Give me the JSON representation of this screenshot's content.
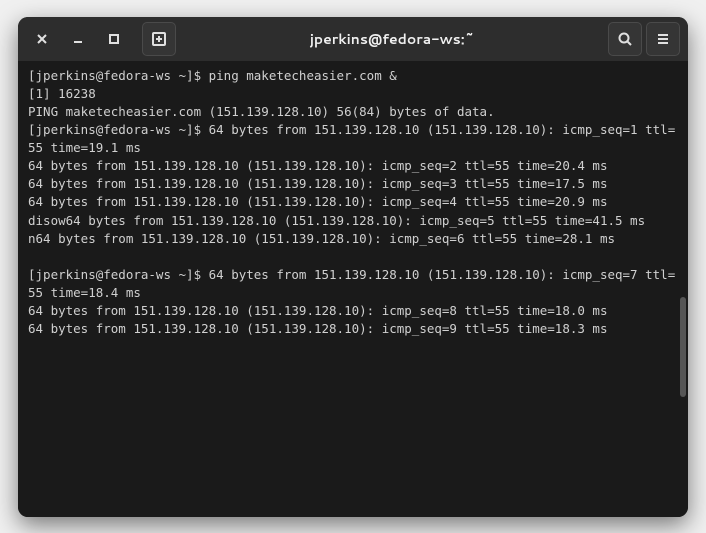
{
  "window": {
    "title": "jperkins@fedora-ws:~"
  },
  "terminal": {
    "lines": [
      {
        "prompt": "[jperkins@fedora-ws ~]$ ",
        "cmd": "ping maketecheasier.com &"
      },
      {
        "text": "[1] 16238"
      },
      {
        "text": "PING maketecheasier.com (151.139.128.10) 56(84) bytes of data."
      },
      {
        "prompt": "[jperkins@fedora-ws ~]$ ",
        "cmd": "64 bytes from 151.139.128.10 (151.139.128.10): icmp_seq=1 ttl=55 time=19.1 ms"
      },
      {
        "text": "64 bytes from 151.139.128.10 (151.139.128.10): icmp_seq=2 ttl=55 time=20.4 ms"
      },
      {
        "text": "64 bytes from 151.139.128.10 (151.139.128.10): icmp_seq=3 ttl=55 time=17.5 ms"
      },
      {
        "text": "64 bytes from 151.139.128.10 (151.139.128.10): icmp_seq=4 ttl=55 time=20.9 ms"
      },
      {
        "text": "disow64 bytes from 151.139.128.10 (151.139.128.10): icmp_seq=5 ttl=55 time=41.5 ms"
      },
      {
        "text": "n64 bytes from 151.139.128.10 (151.139.128.10): icmp_seq=6 ttl=55 time=28.1 ms"
      },
      {
        "empty": true
      },
      {
        "prompt": "[jperkins@fedora-ws ~]$ ",
        "cmd": "64 bytes from 151.139.128.10 (151.139.128.10): icmp_seq=7 ttl=55 time=18.4 ms"
      },
      {
        "text": "64 bytes from 151.139.128.10 (151.139.128.10): icmp_seq=8 ttl=55 time=18.0 ms"
      },
      {
        "text": "64 bytes from 151.139.128.10 (151.139.128.10): icmp_seq=9 ttl=55 time=18.3 ms"
      }
    ]
  }
}
